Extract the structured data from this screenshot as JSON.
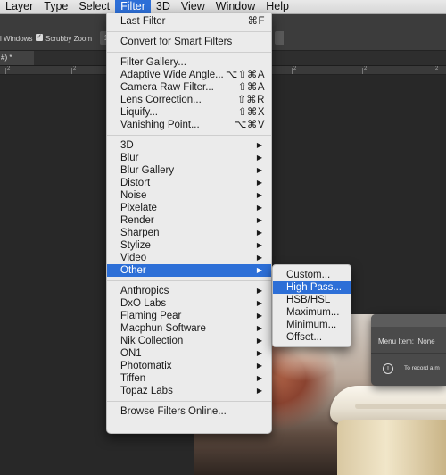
{
  "menubar": [
    {
      "label": "Layer"
    },
    {
      "label": "Type"
    },
    {
      "label": "Select"
    },
    {
      "label": "Filter",
      "active": true
    },
    {
      "label": "3D"
    },
    {
      "label": "View"
    },
    {
      "label": "Window"
    },
    {
      "label": "Help"
    }
  ],
  "options_bar": {
    "windows_label": "l Windows",
    "scrubby_zoom_label": "Scrubby Zoom",
    "scrubby_zoom_checked": true,
    "zoom_field_value": "1"
  },
  "document_tab": {
    "label": "#) *"
  },
  "ruler": {
    "labels": [
      "2",
      "2",
      "2",
      "2",
      "2",
      "2",
      "2"
    ]
  },
  "filter_menu": {
    "items": [
      {
        "label": "Last Filter",
        "shortcut": "⌘F"
      },
      {
        "separator": true
      },
      {
        "label": "Convert for Smart Filters"
      },
      {
        "separator": true
      },
      {
        "label": "Filter Gallery..."
      },
      {
        "label": "Adaptive Wide Angle...",
        "shortcut": "⌥⇧⌘A"
      },
      {
        "label": "Camera Raw Filter...",
        "shortcut": "⇧⌘A"
      },
      {
        "label": "Lens Correction...",
        "shortcut": "⇧⌘R"
      },
      {
        "label": "Liquify...",
        "shortcut": "⇧⌘X"
      },
      {
        "label": "Vanishing Point...",
        "shortcut": "⌥⌘V"
      },
      {
        "separator": true
      },
      {
        "label": "3D",
        "submenu": true
      },
      {
        "label": "Blur",
        "submenu": true
      },
      {
        "label": "Blur Gallery",
        "submenu": true
      },
      {
        "label": "Distort",
        "submenu": true
      },
      {
        "label": "Noise",
        "submenu": true
      },
      {
        "label": "Pixelate",
        "submenu": true
      },
      {
        "label": "Render",
        "submenu": true
      },
      {
        "label": "Sharpen",
        "submenu": true
      },
      {
        "label": "Stylize",
        "submenu": true
      },
      {
        "label": "Video",
        "submenu": true
      },
      {
        "label": "Other",
        "submenu": true,
        "highlighted": true
      },
      {
        "separator": true
      },
      {
        "label": "Anthropics",
        "submenu": true
      },
      {
        "label": "DxO Labs",
        "submenu": true
      },
      {
        "label": "Flaming Pear",
        "submenu": true
      },
      {
        "label": "Macphun Software",
        "submenu": true
      },
      {
        "label": "Nik Collection",
        "submenu": true
      },
      {
        "label": "ON1",
        "submenu": true
      },
      {
        "label": "Photomatix",
        "submenu": true
      },
      {
        "label": "Tiffen",
        "submenu": true
      },
      {
        "label": "Topaz Labs",
        "submenu": true
      },
      {
        "separator": true
      },
      {
        "label": "Browse Filters Online..."
      }
    ]
  },
  "other_submenu": {
    "items": [
      {
        "label": "Custom..."
      },
      {
        "label": "High Pass...",
        "highlighted": true
      },
      {
        "label": "HSB/HSL"
      },
      {
        "label": "Maximum..."
      },
      {
        "label": "Minimum..."
      },
      {
        "label": "Offset..."
      }
    ]
  },
  "actions_dialog": {
    "menu_item_label": "Menu Item:",
    "menu_item_value": "None",
    "info_text": "To record a m",
    "info_icon": "info-icon"
  },
  "colors": {
    "highlight": "#2d6fd7",
    "menu_bg": "#ebebeb",
    "workspace_bg": "#282828"
  }
}
